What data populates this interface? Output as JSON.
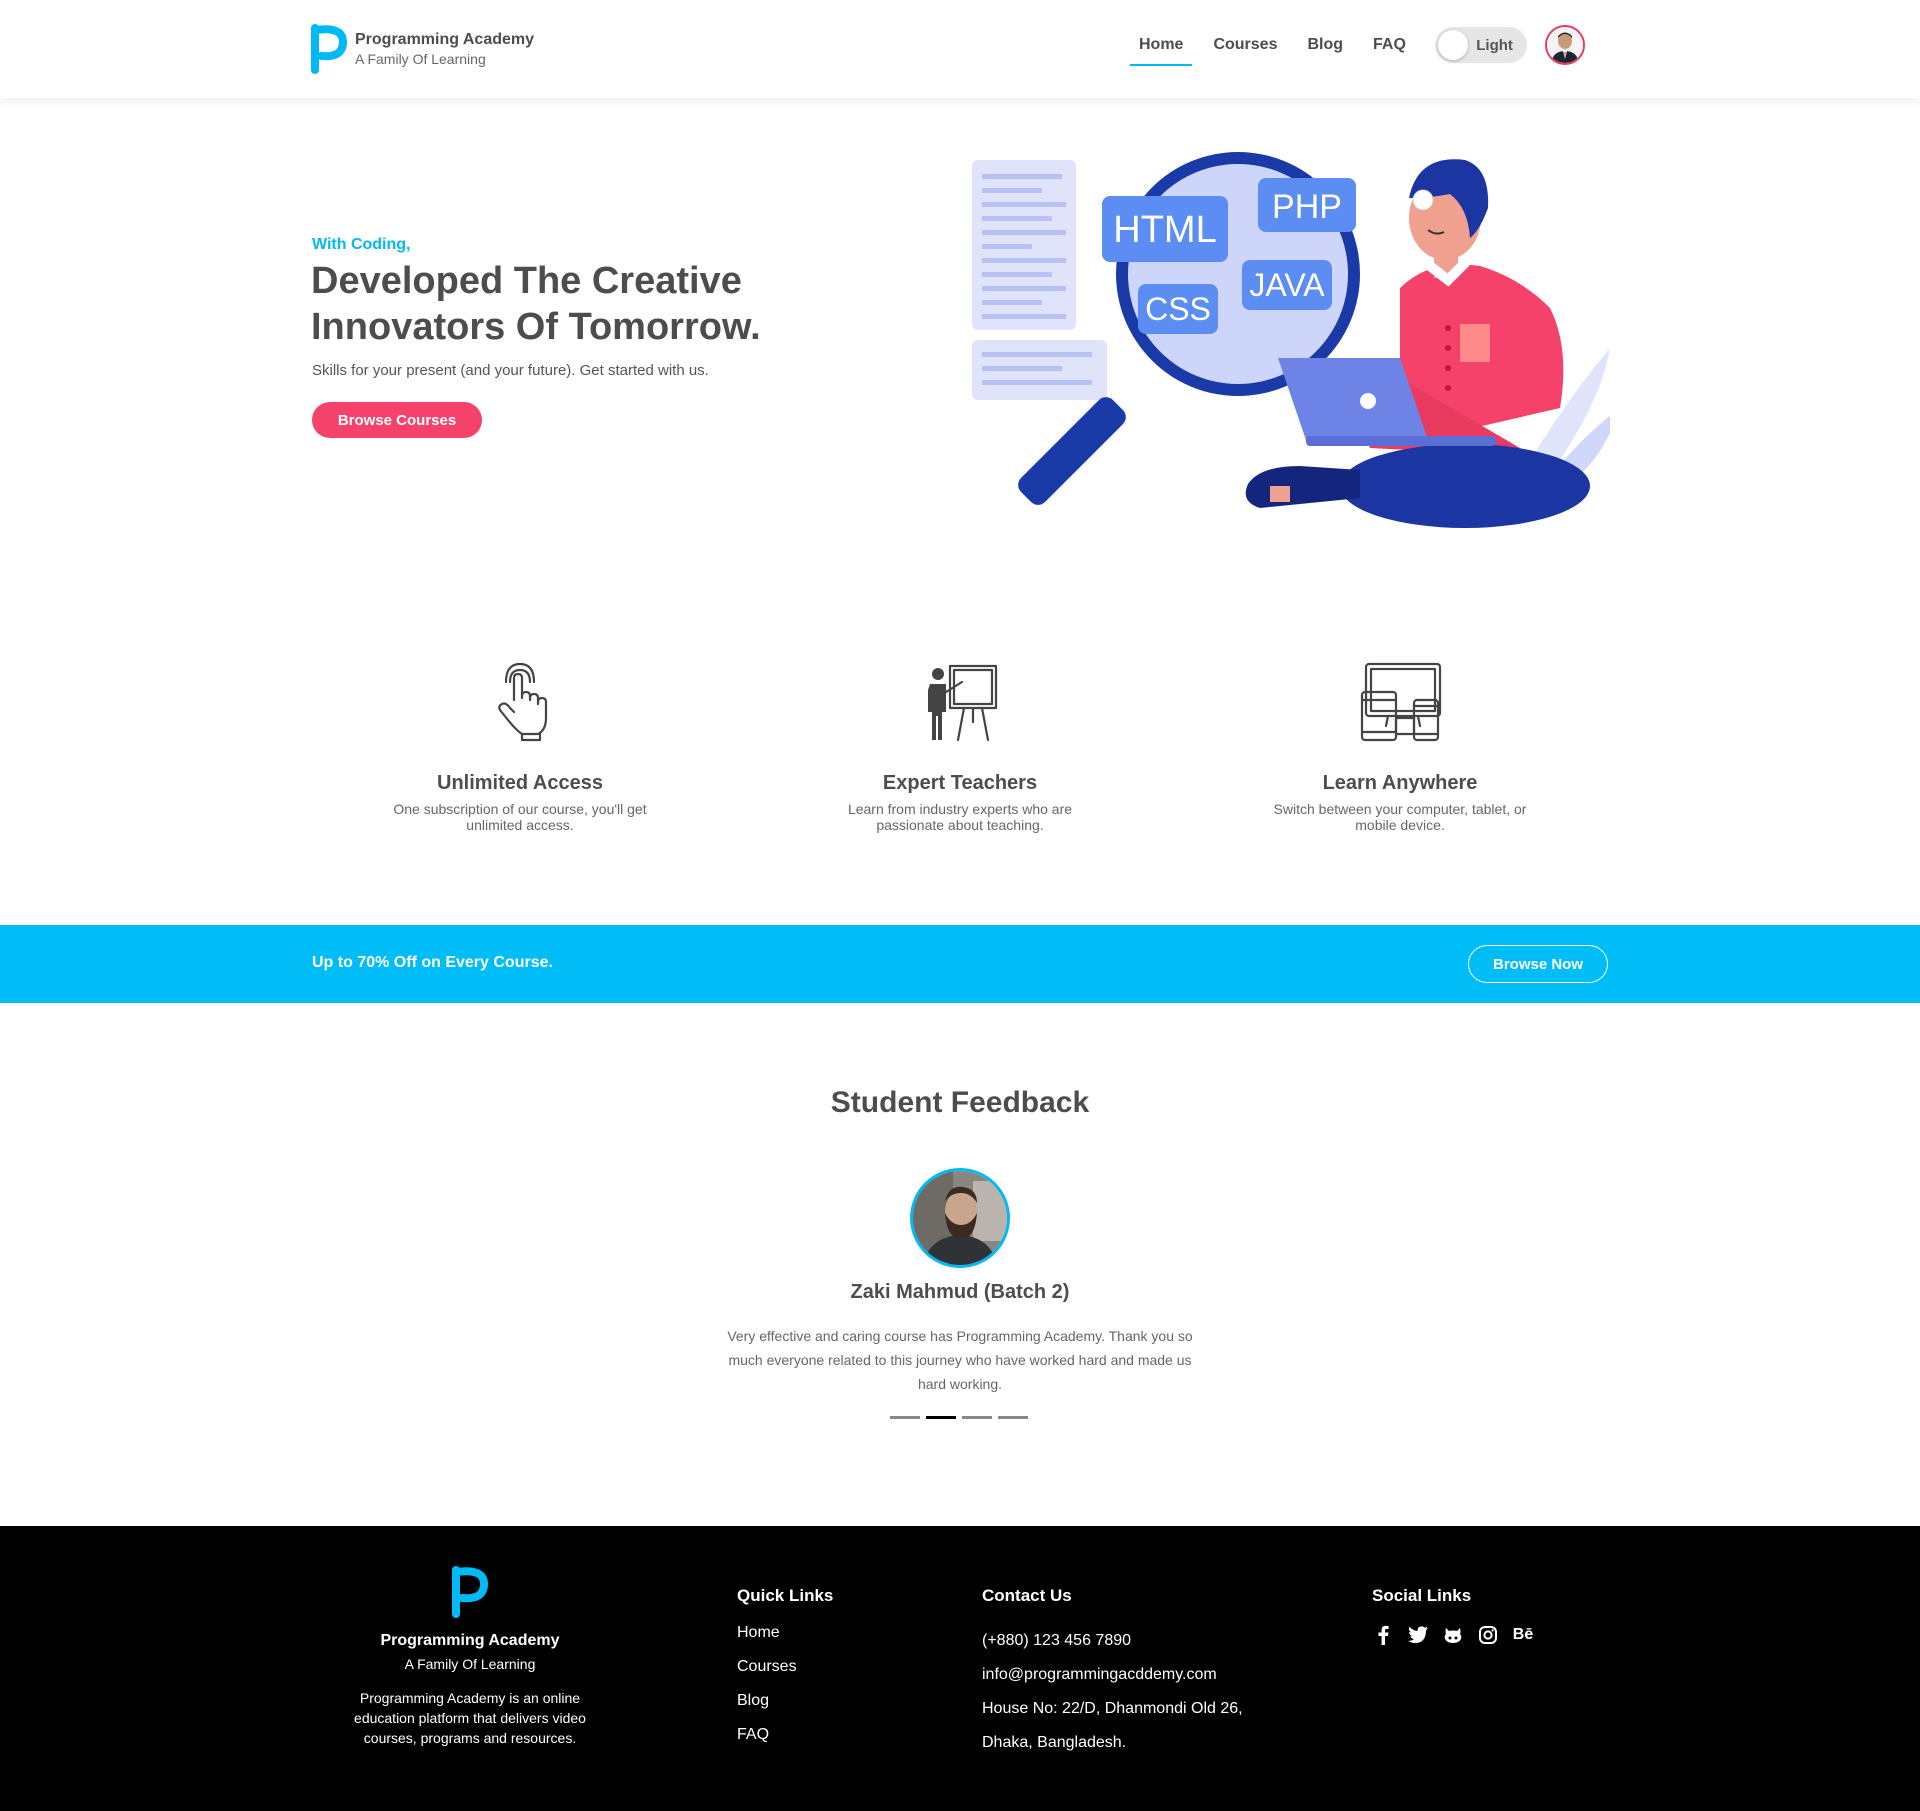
{
  "brand": {
    "name": "Programming Academy",
    "tagline": "A Family Of Learning"
  },
  "nav": {
    "links": [
      "Home",
      "Courses",
      "Blog",
      "FAQ"
    ],
    "active": "Home",
    "theme_toggle_label": "Light"
  },
  "hero": {
    "subtitle": "With Coding,",
    "title": "Developed The Creative Innovators Of Tomorrow.",
    "description": "Skills for your present (and your future). Get started with us.",
    "cta_label": "Browse Courses",
    "illustration_labels": [
      "HTML",
      "PHP",
      "CSS",
      "JAVA"
    ]
  },
  "features": [
    {
      "icon": "touch-icon",
      "title": "Unlimited Access",
      "description": "One subscription of our course, you'll get unlimited access."
    },
    {
      "icon": "teacher-icon",
      "title": "Expert Teachers",
      "description": "Learn from industry experts who are passionate about teaching."
    },
    {
      "icon": "devices-icon",
      "title": "Learn Anywhere",
      "description": "Switch between your computer, tablet, or mobile device."
    }
  ],
  "promo": {
    "text": "Up to 70% Off on Every Course.",
    "button_label": "Browse Now"
  },
  "feedback": {
    "title": "Student Feedback",
    "name": "Zaki Mahmud (Batch 2)",
    "text": "Very effective and caring course has Programming Academy. Thank you so much everyone related to this journey who have worked hard and made us hard working.",
    "active_slide": 2,
    "total_slides": 4
  },
  "footer": {
    "brand_name": "Programming Academy",
    "tagline": "A Family Of Learning",
    "description": "Programming Academy is an online education platform that delivers video courses, programs and resources.",
    "quick_links_title": "Quick Links",
    "quick_links": [
      "Home",
      "Courses",
      "Blog",
      "FAQ"
    ],
    "contact_title": "Contact Us",
    "phone": "(+880) 123 456 7890",
    "email": "info@programmingacddemy.com",
    "address_line1": "House No: 22/D, Dhanmondi Old 26,",
    "address_line2": "Dhaka, Bangladesh.",
    "social_title": "Social Links",
    "social_icons": [
      "facebook-icon",
      "twitter-icon",
      "github-icon",
      "instagram-icon",
      "behance-icon"
    ],
    "behance_text": "Bē"
  },
  "colors": {
    "accent": "#00b9f5",
    "cta": "#f4426a",
    "promo_bg": "#00bdf7",
    "footer_bg": "#000000"
  }
}
